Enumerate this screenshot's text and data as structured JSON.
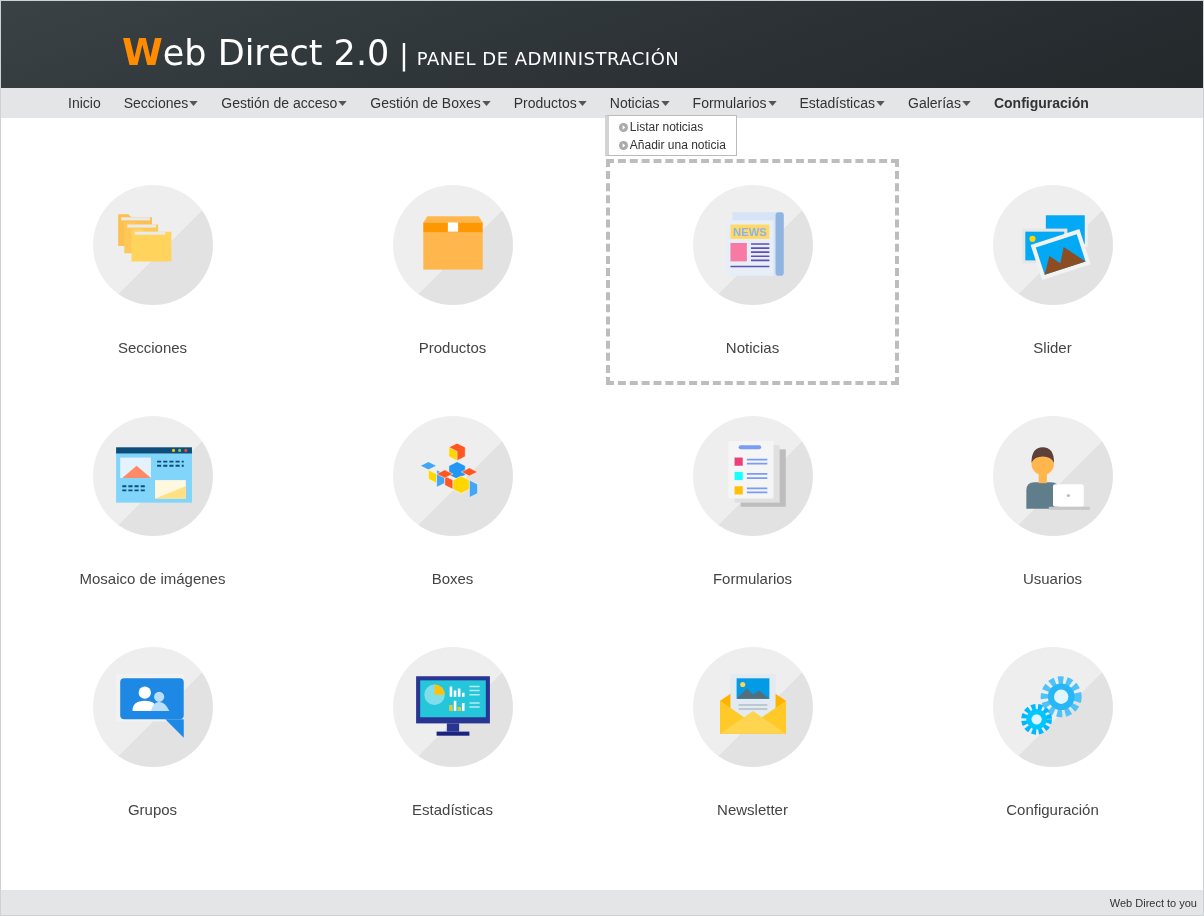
{
  "header": {
    "logo_initial": "W",
    "logo_text": "eb Direct 2.0",
    "separator": "|",
    "subtitle": "PANEL DE ADMINISTRACIÓN"
  },
  "nav": [
    {
      "label": "Inicio",
      "has_menu": false,
      "selected": false
    },
    {
      "label": "Secciones",
      "has_menu": true,
      "selected": false
    },
    {
      "label": "Gestión de acceso",
      "has_menu": true,
      "selected": false
    },
    {
      "label": "Gestión de Boxes",
      "has_menu": true,
      "selected": false
    },
    {
      "label": "Productos",
      "has_menu": true,
      "selected": false
    },
    {
      "label": "Noticias",
      "has_menu": true,
      "selected": false,
      "menu": [
        "Listar noticias",
        "Añadir una noticia"
      ]
    },
    {
      "label": "Formularios",
      "has_menu": true,
      "selected": false
    },
    {
      "label": "Estadísticas",
      "has_menu": true,
      "selected": false
    },
    {
      "label": "Galerías",
      "has_menu": true,
      "selected": false
    },
    {
      "label": "Configuración",
      "has_menu": false,
      "selected": true
    }
  ],
  "tiles": [
    {
      "label": "Secciones",
      "kind": "folders",
      "selected": false
    },
    {
      "label": "Productos",
      "kind": "box",
      "selected": false
    },
    {
      "label": "Noticias",
      "kind": "news",
      "selected": true,
      "icon_text": "NEWS"
    },
    {
      "label": "Slider",
      "kind": "photos",
      "selected": false
    },
    {
      "label": "Mosaico de imágenes",
      "kind": "mosaic",
      "selected": false
    },
    {
      "label": "Boxes",
      "kind": "cubes",
      "selected": false
    },
    {
      "label": "Formularios",
      "kind": "form",
      "selected": false
    },
    {
      "label": "Usuarios",
      "kind": "user",
      "selected": false
    },
    {
      "label": "Grupos",
      "kind": "group",
      "selected": false
    },
    {
      "label": "Estadísticas",
      "kind": "monitor",
      "selected": false
    },
    {
      "label": "Newsletter",
      "kind": "envelope",
      "selected": false
    },
    {
      "label": "Configuración",
      "kind": "gears",
      "selected": false
    }
  ],
  "footer": {
    "text": "Web Direct to you"
  }
}
